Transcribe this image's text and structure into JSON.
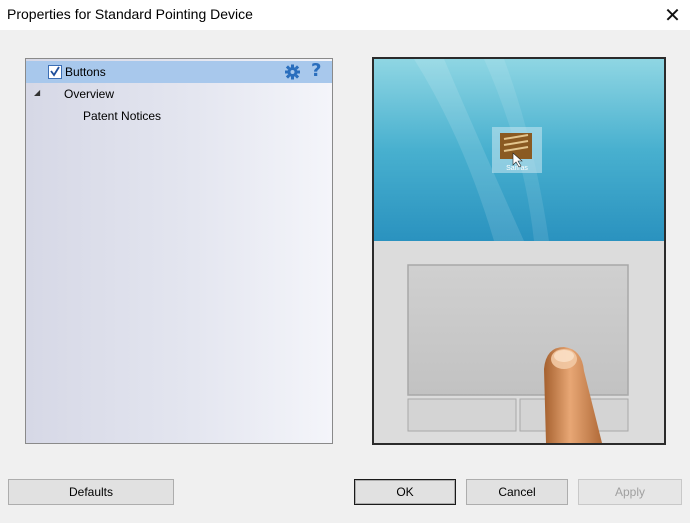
{
  "window": {
    "title": "Properties for Standard Pointing Device",
    "close_glyph": "✕"
  },
  "tree": {
    "items": [
      {
        "label": "Buttons",
        "checked": true,
        "selected": true
      },
      {
        "label": "Overview",
        "expander": "◢"
      },
      {
        "label": "Patent Notices"
      }
    ],
    "help_glyph": "?"
  },
  "preview": {
    "icon_name": "touchpad-animation",
    "desktop_icon_caption": "Saifras"
  },
  "buttons": {
    "defaults": "Defaults",
    "ok": "OK",
    "cancel": "Cancel",
    "apply": "Apply"
  },
  "colors": {
    "selection": "#a8c8ec",
    "accent": "#2a6ebd"
  }
}
